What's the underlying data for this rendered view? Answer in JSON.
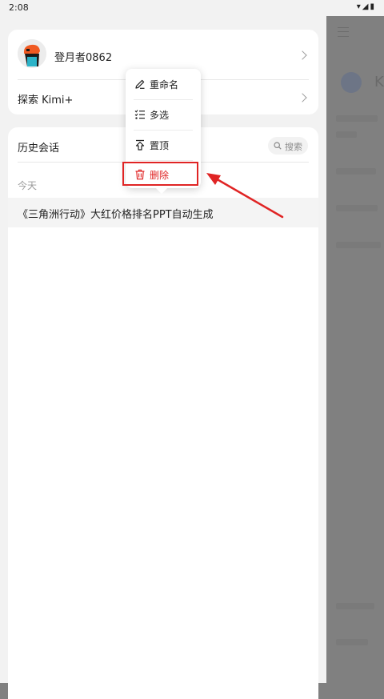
{
  "status_bar": {
    "time": "2:08",
    "icons": "▾◢▮"
  },
  "right_pane": {
    "peek_letter": "K"
  },
  "user": {
    "name": "登月者0862",
    "explore_label": "探索 Kimi+"
  },
  "history": {
    "title": "历史会话",
    "search_label": "搜索",
    "sections": [
      {
        "label": "今天",
        "items": [
          {
            "title": "《三角洲行动》大红价格排名PPT自动生成"
          }
        ]
      }
    ]
  },
  "context_menu": {
    "items": [
      {
        "label": "重命名",
        "icon": "pencil-icon"
      },
      {
        "label": "多选",
        "icon": "checklist-icon"
      },
      {
        "label": "置顶",
        "icon": "pin-top-icon"
      },
      {
        "label": "删除",
        "icon": "trash-icon",
        "color": "#e02424"
      }
    ]
  },
  "colors": {
    "accent_red": "#e02424",
    "drawer_bg": "#f2f2f2",
    "dim_overlay": "#808080"
  }
}
